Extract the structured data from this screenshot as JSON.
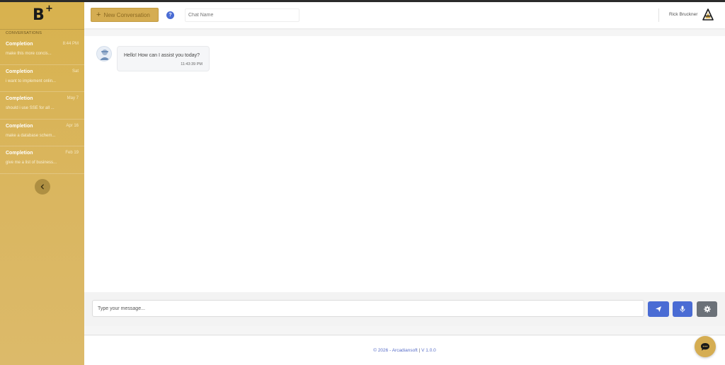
{
  "brand": {
    "logo_letter": "B",
    "logo_plus": "+"
  },
  "sidebar": {
    "section_label": "CONVERSATIONS",
    "conversations": [
      {
        "title": "Completion",
        "date": "8:44 PM",
        "snippet": "make this more concis..."
      },
      {
        "title": "Completion",
        "date": "Sat",
        "snippet": "i want to implement onlin..."
      },
      {
        "title": "Completion",
        "date": "May 7",
        "snippet": "should i use SSE for all ..."
      },
      {
        "title": "Completion",
        "date": "Apr 16",
        "snippet": "make a database schem..."
      },
      {
        "title": "Completion",
        "date": "Feb 19",
        "snippet": "give me a list of business..."
      }
    ],
    "collapse_icon": "chevron-left-icon"
  },
  "header": {
    "new_conversation_label": "New Conversation",
    "help_label": "?",
    "chat_name_placeholder": "Chat Name",
    "user_name": "Rick Bruckner"
  },
  "messages": [
    {
      "sender": "assistant",
      "text": "Hello! How can I assist you today?",
      "time": "11:43:39 PM"
    }
  ],
  "composer": {
    "placeholder": "Type your message...",
    "send_icon": "send-icon",
    "mic_icon": "microphone-icon",
    "settings_icon": "gear-icon"
  },
  "footer": {
    "copyright_prefix": "© 2026 - Arcadiansoft",
    "separator": "|",
    "version": "V 1.0.0"
  },
  "colors": {
    "sidebar_gold": "#d8b24e",
    "accent_blue": "#4a6cd4",
    "settings_gray": "#6b7178"
  }
}
